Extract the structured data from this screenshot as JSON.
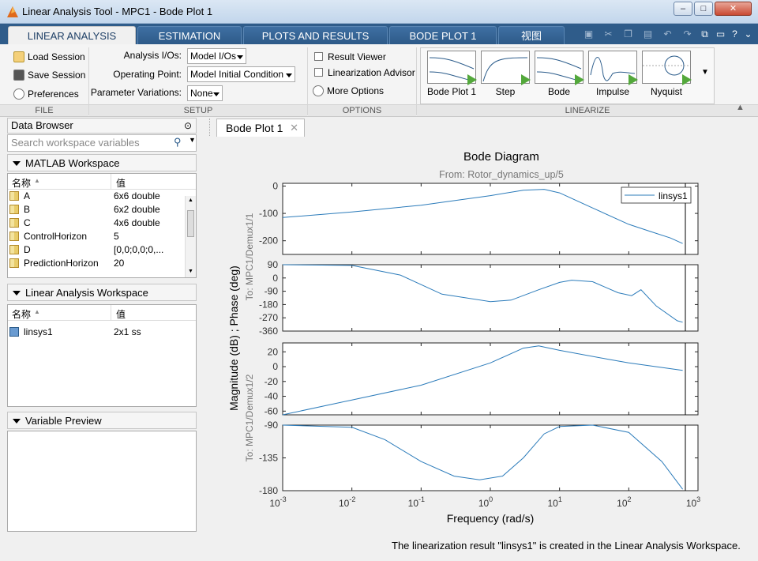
{
  "window": {
    "title": "Linear Analysis Tool - MPC1 - Bode Plot 1"
  },
  "tabs": [
    {
      "label": "LINEAR ANALYSIS"
    },
    {
      "label": "ESTIMATION"
    },
    {
      "label": "PLOTS AND RESULTS"
    },
    {
      "label": "BODE PLOT 1"
    },
    {
      "label": "视图"
    }
  ],
  "ribbon": {
    "file": {
      "load": "Load Session",
      "save": "Save Session",
      "prefs": "Preferences",
      "label": "FILE"
    },
    "setup": {
      "analysis_ios_label": "Analysis I/Os:",
      "analysis_ios_value": "Model I/Os",
      "operating_point_label": "Operating Point:",
      "operating_point_value": "Model Initial Condition",
      "param_var_label": "Parameter Variations:",
      "param_var_value": "None",
      "label": "SETUP"
    },
    "options": {
      "result_viewer": "Result Viewer",
      "lin_advisor": "Linearization Advisor",
      "more": "More Options",
      "label": "OPTIONS"
    },
    "linearize": {
      "label": "LINEARIZE",
      "items": [
        {
          "label": "Bode Plot 1"
        },
        {
          "label": "Step"
        },
        {
          "label": "Bode"
        },
        {
          "label": "Impulse"
        },
        {
          "label": "Nyquist"
        }
      ]
    }
  },
  "data_browser": {
    "title": "Data Browser",
    "search_placeholder": "Search workspace variables",
    "matlab_ws": {
      "title": "MATLAB Workspace",
      "col_name": "名称",
      "col_value": "值",
      "rows": [
        {
          "name": "A",
          "value": "6x6 double"
        },
        {
          "name": "B",
          "value": "6x2 double"
        },
        {
          "name": "C",
          "value": "4x6 double"
        },
        {
          "name": "ControlHorizon",
          "value": "5"
        },
        {
          "name": "D",
          "value": "[0,0;0,0;0,..."
        },
        {
          "name": "PredictionHorizon",
          "value": "20"
        }
      ]
    },
    "linear_ws": {
      "title": "Linear Analysis Workspace",
      "col_name": "名称",
      "col_value": "值",
      "rows": [
        {
          "name": "linsys1",
          "value": "2x1 ss"
        }
      ]
    },
    "preview": {
      "title": "Variable Preview"
    }
  },
  "document": {
    "tab_label": "Bode Plot 1"
  },
  "chart_data": {
    "type": "line",
    "title": "Bode Diagram",
    "subtitle": "From: Rotor_dynamics_up/5",
    "xlabel": "Frequency  (rad/s)",
    "ylabel": "Magnitude (dB) ; Phase (deg)",
    "xscale": "log",
    "xlim": [
      0.001,
      1000
    ],
    "x_tick_labels": [
      "10^-3",
      "10^-2",
      "10^-1",
      "10^0",
      "10^1",
      "10^2",
      "10^3"
    ],
    "legend": {
      "entries": [
        "linsys1"
      ],
      "placement": "top-right"
    },
    "row_labels": [
      "To: MPC1/Demux1/1",
      "To: MPC1/Demux1/2"
    ],
    "panels": [
      {
        "kind": "magnitude",
        "output": 1,
        "ylim": [
          -250,
          10
        ],
        "yticks": [
          0,
          -100,
          -200
        ],
        "series": {
          "name": "linsys1",
          "x": [
            0.001,
            0.01,
            0.1,
            1,
            3,
            6,
            10,
            30,
            100,
            200,
            400,
            600
          ],
          "y": [
            -115,
            -95,
            -70,
            -35,
            -15,
            -12,
            -25,
            -80,
            -140,
            -165,
            -190,
            -210
          ]
        }
      },
      {
        "kind": "phase",
        "output": 1,
        "ylim": [
          -360,
          90
        ],
        "yticks": [
          90,
          0,
          -90,
          -180,
          -270,
          -360
        ],
        "series": {
          "name": "linsys1",
          "x": [
            0.001,
            0.01,
            0.05,
            0.2,
            1,
            2,
            5,
            10,
            15,
            30,
            70,
            110,
            150,
            250,
            500,
            600
          ],
          "y": [
            90,
            85,
            20,
            -110,
            -160,
            -150,
            -80,
            -30,
            -15,
            -25,
            -100,
            -120,
            -80,
            -190,
            -290,
            -300
          ]
        }
      },
      {
        "kind": "magnitude",
        "output": 2,
        "ylim": [
          -65,
          32
        ],
        "yticks": [
          20,
          0,
          -20,
          -40,
          -60
        ],
        "series": {
          "name": "linsys1",
          "x": [
            0.001,
            0.01,
            0.1,
            1,
            3,
            5,
            10,
            50,
            100,
            600
          ],
          "y": [
            -65,
            -45,
            -25,
            5,
            25,
            28,
            22,
            10,
            5,
            -5
          ]
        }
      },
      {
        "kind": "phase",
        "output": 2,
        "ylim": [
          -180,
          -90
        ],
        "yticks": [
          -90,
          -135,
          -180
        ],
        "series": {
          "name": "linsys1",
          "x": [
            0.001,
            0.01,
            0.03,
            0.1,
            0.3,
            0.7,
            1.5,
            3,
            6,
            10,
            30,
            100,
            300,
            600
          ],
          "y": [
            -90,
            -93,
            -110,
            -140,
            -160,
            -165,
            -160,
            -135,
            -102,
            -92,
            -90,
            -100,
            -140,
            -178
          ]
        }
      }
    ]
  },
  "status_message": "The linearization result \"linsys1\" is created in the Linear Analysis Workspace."
}
